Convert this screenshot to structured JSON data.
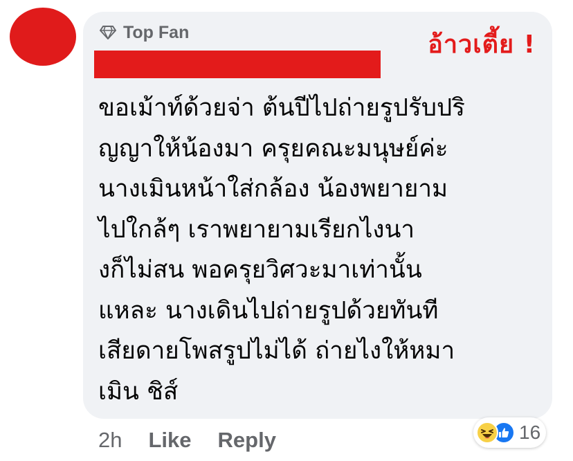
{
  "comment": {
    "badge_label": "Top Fan",
    "badge_icon": "diamond-icon",
    "overlay_caption": "อ้าวเตี้ย !",
    "lines": [
      "ขอเม้าท์ด้วยจ่า ต้นปีไปถ่ายรูปรับปริ",
      "ญญาให้น้องมา ครุยคณะมนุษย์ค่ะ",
      "นางเมินหน้าใส่กล้อง น้องพยายาม",
      "ไปใกล้ๆ เราพยายามเรียกไงนา",
      "งก็ไม่สน พอครุยวิศวะมาเท่านั้น",
      "แหละ นางเดินไปถ่ายรูปด้วยทันที",
      "เสียดายโพสรูปไม่ได้ ถ่ายไงให้หมา",
      "เมิน ชิส์"
    ]
  },
  "actions": {
    "time": "2h",
    "like_label": "Like",
    "reply_label": "Reply"
  },
  "reactions": {
    "icons": [
      "haha-emoji-icon",
      "like-thumb-icon"
    ],
    "count": "16"
  },
  "colors": {
    "redaction": "#e31b1b",
    "bubble": "#f0f2f5",
    "meta_text": "#65676b",
    "like_blue": "#1877f2",
    "haha_yellow": "#f7d046"
  }
}
